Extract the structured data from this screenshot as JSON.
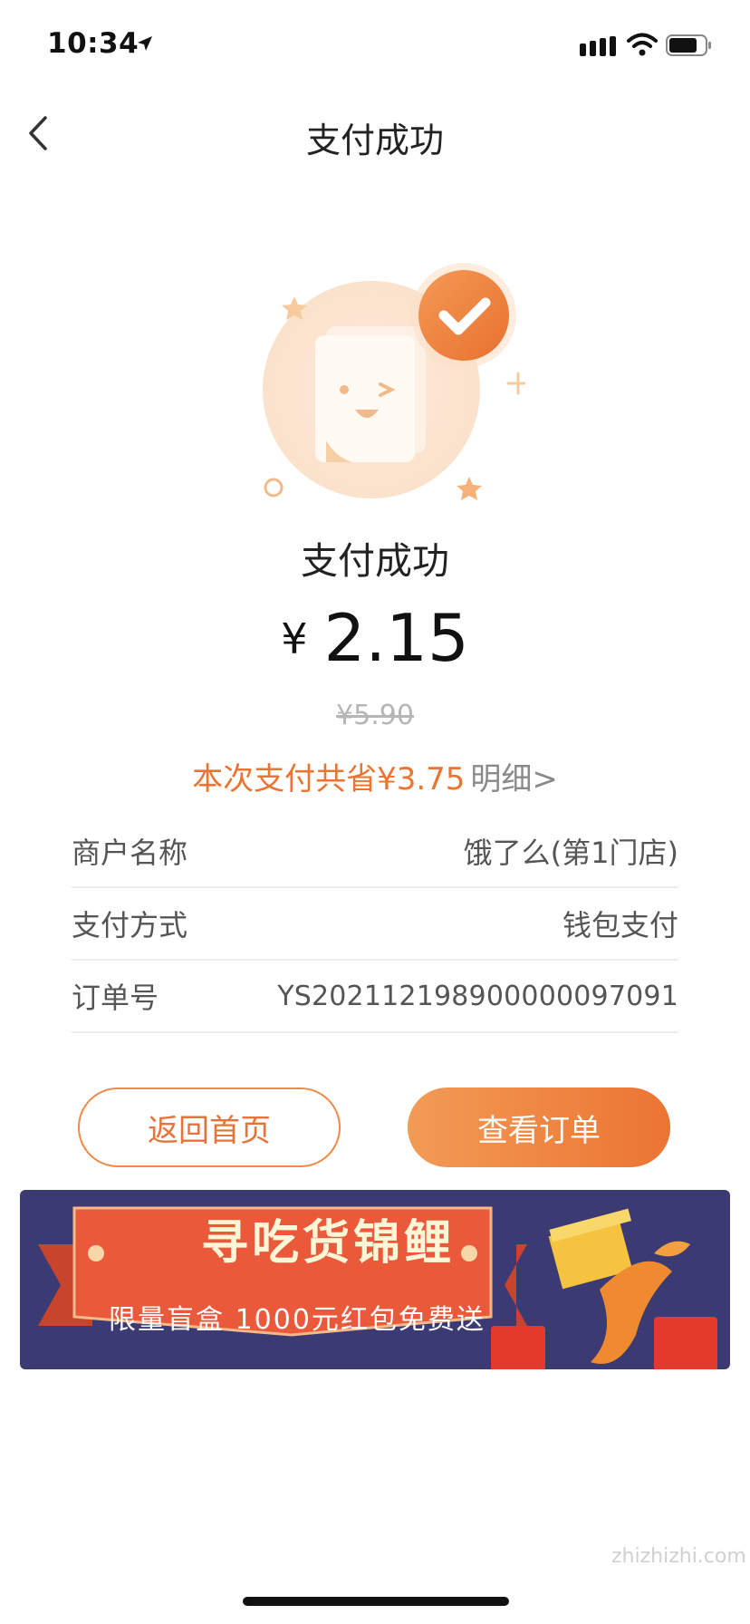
{
  "status": {
    "time": "10:34"
  },
  "nav": {
    "title": "支付成功"
  },
  "result": {
    "title": "支付成功",
    "currency": "¥",
    "amount": "2.15",
    "original_price": "¥5.90",
    "saving_text": "本次支付共省¥3.75",
    "detail_link": "明细>"
  },
  "info_rows": [
    {
      "label": "商户名称",
      "value": "饿了么(第1门店)"
    },
    {
      "label": "支付方式",
      "value": "钱包支付"
    },
    {
      "label": "订单号",
      "value": "YS20211219890000009709​1"
    }
  ],
  "buttons": {
    "home": "返回首页",
    "view_order": "查看订单"
  },
  "banner": {
    "title": "寻吃货锦鲤",
    "subtitle": "限量盲盒 1000元红包免费送"
  },
  "watermark": "zhizhizhi.com",
  "colors": {
    "accent": "#ec7433",
    "banner_bg": "#3b3a72"
  }
}
